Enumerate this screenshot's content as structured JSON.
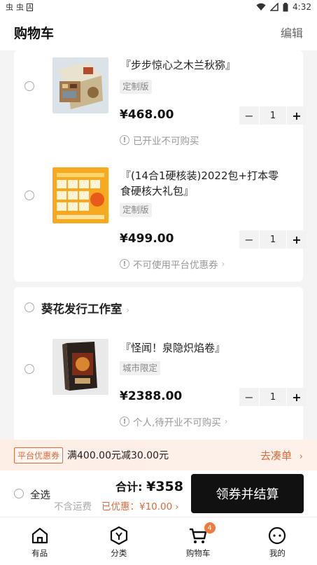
{
  "status_bar": {
    "left_glyphs": [
      "虫",
      "虫",
      "A"
    ],
    "time": "4:32"
  },
  "header": {
    "title": "购物车",
    "edit_label": "编辑"
  },
  "items": [
    {
      "name": "『步步惊心之木兰秋猕』",
      "tag": "定制版",
      "price": "¥468.00",
      "qty": "1",
      "notice": "已开业不可购买",
      "notice_has_chevron": false
    },
    {
      "name": "『(14合1硬核装)2022包+打本零食硬核大礼包』",
      "tag": "定制版",
      "price": "¥499.00",
      "qty": "1",
      "notice": "不可使用平台优惠券",
      "notice_has_chevron": true
    }
  ],
  "shop": {
    "name": "葵花发行工作室",
    "items": [
      {
        "name": "『怪闻！泉隐炽焰卷』",
        "tag": "城市限定",
        "price": "¥2388.00",
        "qty": "1",
        "notice": "个人,待开业不可购买",
        "notice_has_chevron": true
      }
    ]
  },
  "stepper": {
    "minus": "−",
    "plus": "+"
  },
  "promo": {
    "badge": "平台优惠券",
    "text": "满400.00元减30.00元",
    "gather": "去凑单"
  },
  "checkout": {
    "select_all": "全选",
    "total_label": "合计:",
    "total_amount": "¥358",
    "freight": "不含运费",
    "saved": "已优惠：¥10.00",
    "pay_button": "领券并结算"
  },
  "tabs": [
    {
      "label": "有品",
      "icon": "home-icon"
    },
    {
      "label": "分类",
      "icon": "category-icon"
    },
    {
      "label": "购物车",
      "icon": "cart-icon",
      "badge": "4"
    },
    {
      "label": "我的",
      "icon": "profile-icon"
    }
  ],
  "colors": {
    "accent": "#e06a3b",
    "badge": "#f07a3c",
    "dark": "#111111"
  }
}
